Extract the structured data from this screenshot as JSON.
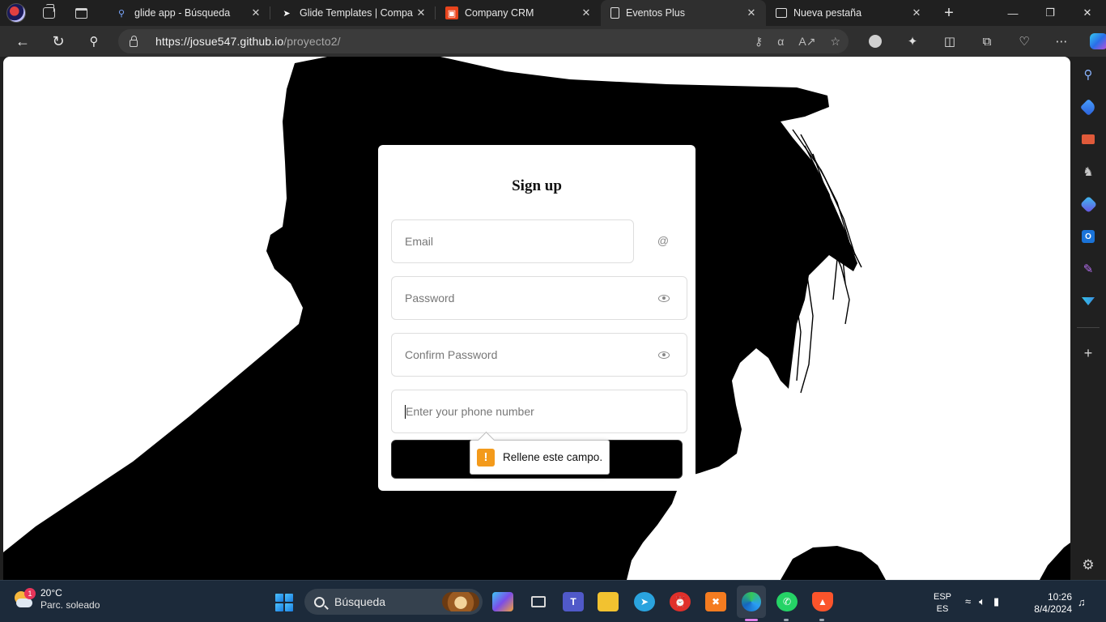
{
  "browser": {
    "tabs": [
      {
        "title": "glide app - Búsqueda",
        "icon": "search-icon",
        "active": false
      },
      {
        "title": "Glide Templates | Compan",
        "icon": "glide-icon",
        "active": false
      },
      {
        "title": "Company CRM",
        "icon": "crm-icon",
        "active": false
      },
      {
        "title": "Eventos Plus",
        "icon": "document-icon",
        "active": true
      },
      {
        "title": "Nueva pestaña",
        "icon": "new-tab-page-icon",
        "active": false
      }
    ],
    "url_host": "https://josue547.github.io",
    "url_path": "/proyecto2/"
  },
  "form": {
    "title": "Sign up",
    "email_placeholder": "Email",
    "password_placeholder": "Password",
    "confirm_placeholder": "Confirm Password",
    "phone_placeholder": "Enter your phone number",
    "validation_message": "Rellene este campo.",
    "at_symbol": "@",
    "warning_symbol": "!"
  },
  "taskbar": {
    "weather_temp": "20°C",
    "weather_desc": "Parc. soleado",
    "weather_badge": "1",
    "search_label": "Búsqueda",
    "lang_top": "ESP",
    "lang_bottom": "ES",
    "time": "10:26",
    "date": "8/4/2024"
  },
  "colors": {
    "accent_orange": "#f39a1b",
    "crm_brand": "#e8441c",
    "silhouette": "#000000"
  }
}
